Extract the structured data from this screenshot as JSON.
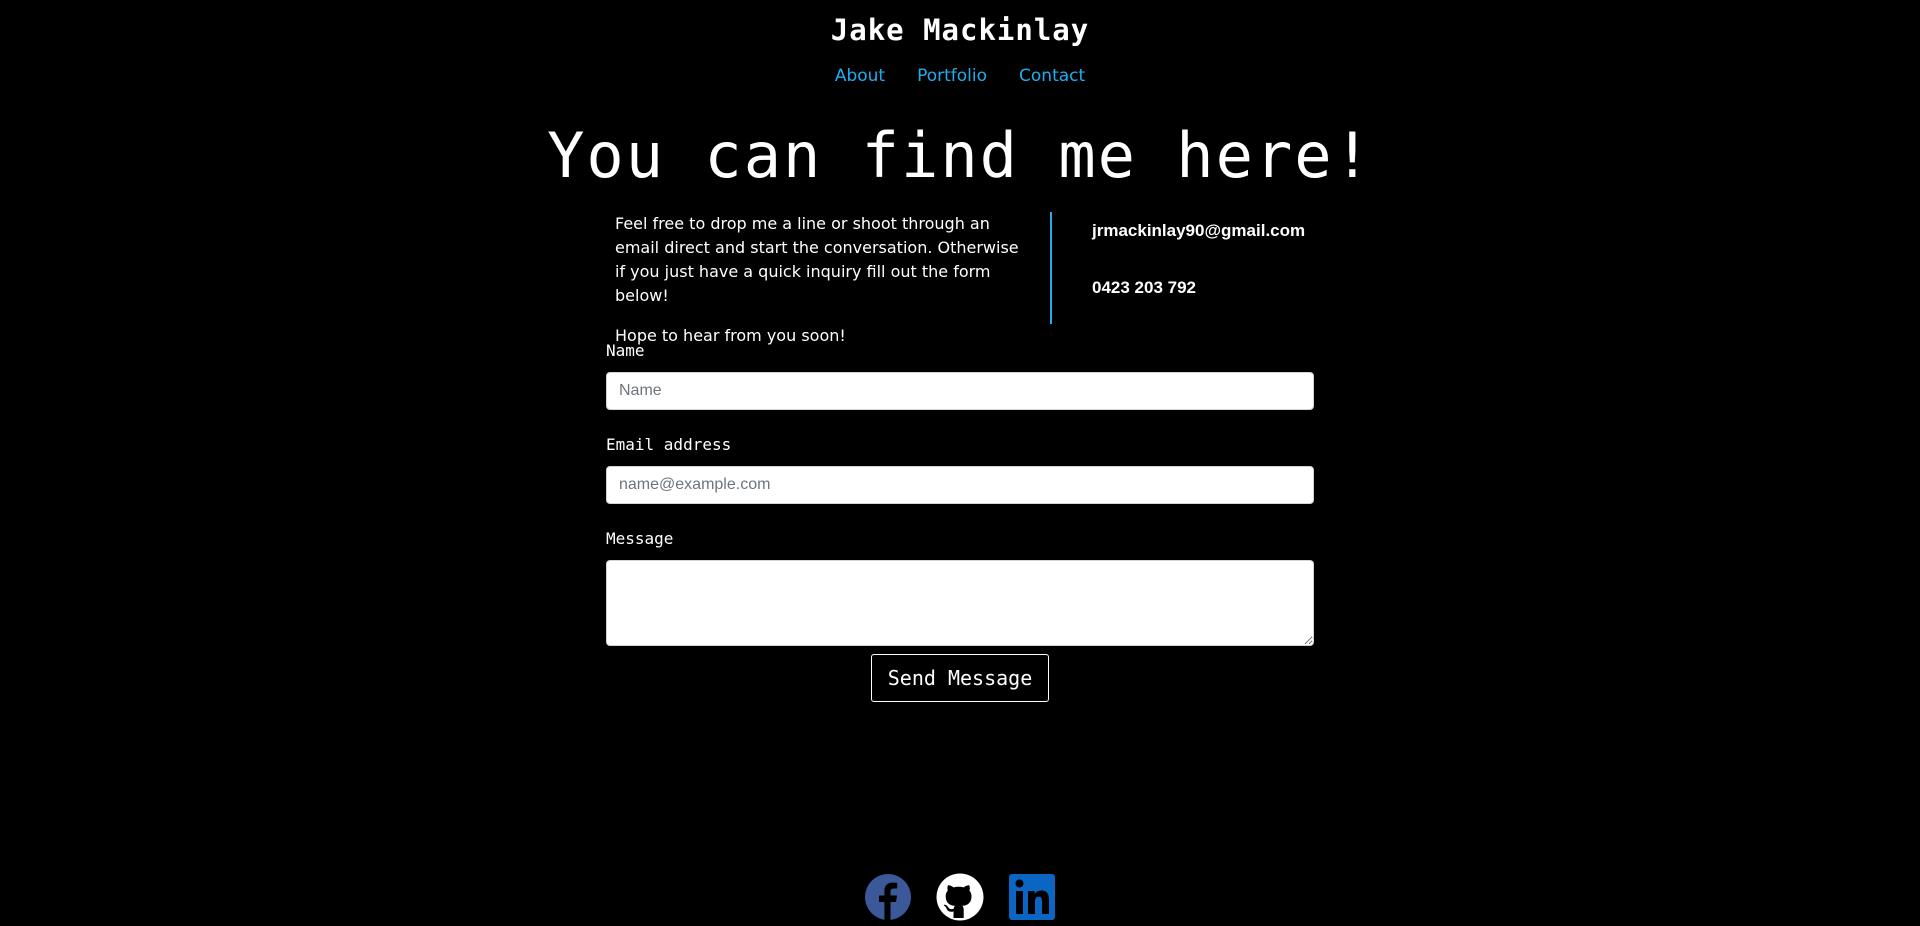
{
  "header": {
    "site_title": "Jake Mackinlay",
    "nav": [
      {
        "label": "About"
      },
      {
        "label": "Portfolio"
      },
      {
        "label": "Contact"
      }
    ],
    "accent_color": "#1eaef0"
  },
  "hero": {
    "heading": "You can find me here!"
  },
  "intro": {
    "paragraph_1": "Feel free to drop me a line or shoot through an email direct and start the conversation. Otherwise if you just have a quick inquiry fill out the form below!",
    "paragraph_2": "Hope to hear from you soon!"
  },
  "contact": {
    "email": "jrmackinlay90@gmail.com",
    "phone": "0423 203 792"
  },
  "form": {
    "name_label": "Name",
    "name_placeholder": "Name",
    "name_value": "",
    "email_label": "Email address",
    "email_placeholder": "name@example.com",
    "email_value": "",
    "message_label": "Message",
    "message_value": "",
    "submit_label": "Send Message"
  },
  "social": {
    "icons": [
      {
        "name": "facebook-icon",
        "color": "#3b5998"
      },
      {
        "name": "github-icon",
        "color": "#ffffff"
      },
      {
        "name": "linkedin-icon",
        "color": "#0a66c2"
      }
    ]
  }
}
